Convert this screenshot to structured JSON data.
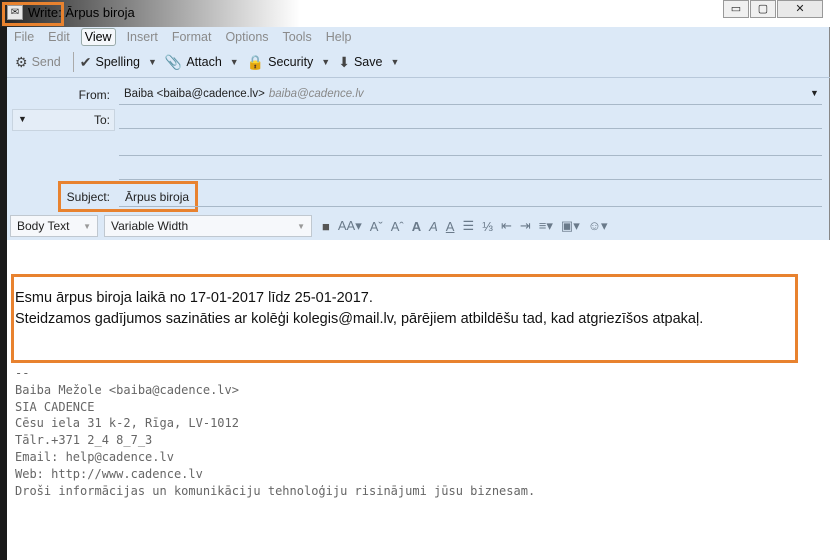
{
  "window": {
    "title": "Write: Ārpus biroja",
    "controls": {
      "minimize": "▭",
      "maximize": "▢",
      "close": "✕"
    }
  },
  "menu": [
    "File",
    "Edit",
    "View",
    "Insert",
    "Format",
    "Options",
    "Tools",
    "Help"
  ],
  "menu_active": "View",
  "toolbar": {
    "send": "Send",
    "spelling": "Spelling",
    "attach": "Attach",
    "security": "Security",
    "save": "Save"
  },
  "header": {
    "from_label": "From:",
    "from_value": "Baiba <baiba@cadence.lv>",
    "from_identity": "baiba@cadence.lv",
    "to_label": "To:",
    "to_value": "",
    "subject_label": "Subject:",
    "subject_value": "Ārpus biroja"
  },
  "format": {
    "paragraph_style": "Body Text",
    "font": "Variable Width"
  },
  "body": {
    "line1": "Esmu ārpus biroja laikā no 17-01-2017 līdz 25-01-2017.",
    "line2": "Steidzamos gadījumos sazināties ar kolēģi kolegis@mail.lv, pārējiem atbildēšu tad, kad atgriezīšos atpakaļ."
  },
  "signature": [
    "--",
    "Baiba Mežole <baiba@cadence.lv>",
    "SIA CADENCE",
    "Cēsu iela 31 k-2, Rīga, LV-1012",
    "Tālr.+371 2_4 8_7_3",
    "Email: help@cadence.lv",
    "Web: http://www.cadence.lv",
    "Droši informācijas un komunikāciju tehnoloģiju risinājumi jūsu biznesam."
  ],
  "colors": {
    "highlight": "#e8822f",
    "header_bg": "#dce9f7"
  }
}
